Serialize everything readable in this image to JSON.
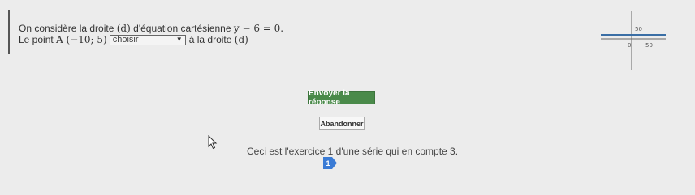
{
  "question": {
    "line1_text": "On considère la droite",
    "line1_d": "(d)",
    "line1_text2": "d'équation cartésienne",
    "line1_equation": "y − 6 = 0.",
    "line2_text": "Le point",
    "line2_point": "A (−10; 5)",
    "line2_suffix": "à la droite",
    "line2_d": "(d)",
    "select_value": "choisir"
  },
  "graph": {
    "y_tick_label": "50",
    "origin_label": "0",
    "x_tick_label": "50",
    "line_color": "#3a6ea5"
  },
  "buttons": {
    "send_label": "Envoyer la réponse",
    "abandon_label": "Abandonner"
  },
  "series": {
    "text": "Ceci est l'exercice 1 d'une série qui en compte 3.",
    "current_number": "1"
  },
  "colors": {
    "send_button": "#4a8a4a",
    "badge": "#3a7bd5"
  },
  "icons": {
    "cursor": "arrow-cursor-icon",
    "dropdown": "chevron-down-icon"
  }
}
